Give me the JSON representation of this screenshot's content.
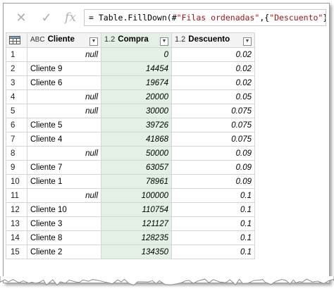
{
  "formula_bar": {
    "cancel_icon": "✕",
    "check_icon": "✓",
    "fx_label": "fx",
    "formula_prefix": "= Table.FillDown(#",
    "formula_str1": "\"Filas ordenadas\"",
    "formula_mid": ",{",
    "formula_str2": "\"Descuento\"",
    "formula_suffix": "})"
  },
  "columns": [
    {
      "type": "ABC",
      "label": "Cliente"
    },
    {
      "type": "1.2",
      "label": "Compra"
    },
    {
      "type": "1.2",
      "label": "Descuento"
    }
  ],
  "dropdown_glyph": "▼",
  "rows": [
    {
      "n": "1",
      "cliente": "null",
      "compra": "0",
      "descuento": "0.02"
    },
    {
      "n": "2",
      "cliente": "Cliente 9",
      "compra": "14454",
      "descuento": "0.02"
    },
    {
      "n": "3",
      "cliente": "Cliente 6",
      "compra": "19674",
      "descuento": "0.02"
    },
    {
      "n": "4",
      "cliente": "null",
      "compra": "20000",
      "descuento": "0.05"
    },
    {
      "n": "5",
      "cliente": "null",
      "compra": "30000",
      "descuento": "0.075"
    },
    {
      "n": "6",
      "cliente": "Cliente 5",
      "compra": "39726",
      "descuento": "0.075"
    },
    {
      "n": "7",
      "cliente": "Cliente 4",
      "compra": "41868",
      "descuento": "0.075"
    },
    {
      "n": "8",
      "cliente": "null",
      "compra": "50000",
      "descuento": "0.09"
    },
    {
      "n": "9",
      "cliente": "Cliente 7",
      "compra": "63057",
      "descuento": "0.09"
    },
    {
      "n": "10",
      "cliente": "Cliente 1",
      "compra": "78961",
      "descuento": "0.09"
    },
    {
      "n": "11",
      "cliente": "null",
      "compra": "100000",
      "descuento": "0.1"
    },
    {
      "n": "12",
      "cliente": "Cliente 10",
      "compra": "110754",
      "descuento": "0.1"
    },
    {
      "n": "13",
      "cliente": "Cliente 3",
      "compra": "121127",
      "descuento": "0.1"
    },
    {
      "n": "14",
      "cliente": "Cliente 8",
      "compra": "128235",
      "descuento": "0.1"
    },
    {
      "n": "15",
      "cliente": "Cliente 2",
      "compra": "134350",
      "descuento": "0.1"
    }
  ],
  "colors": {
    "selected_column_bg": "#e2f0e5",
    "header_bg": "#f3f3f3",
    "formula_string": "#a31515"
  }
}
